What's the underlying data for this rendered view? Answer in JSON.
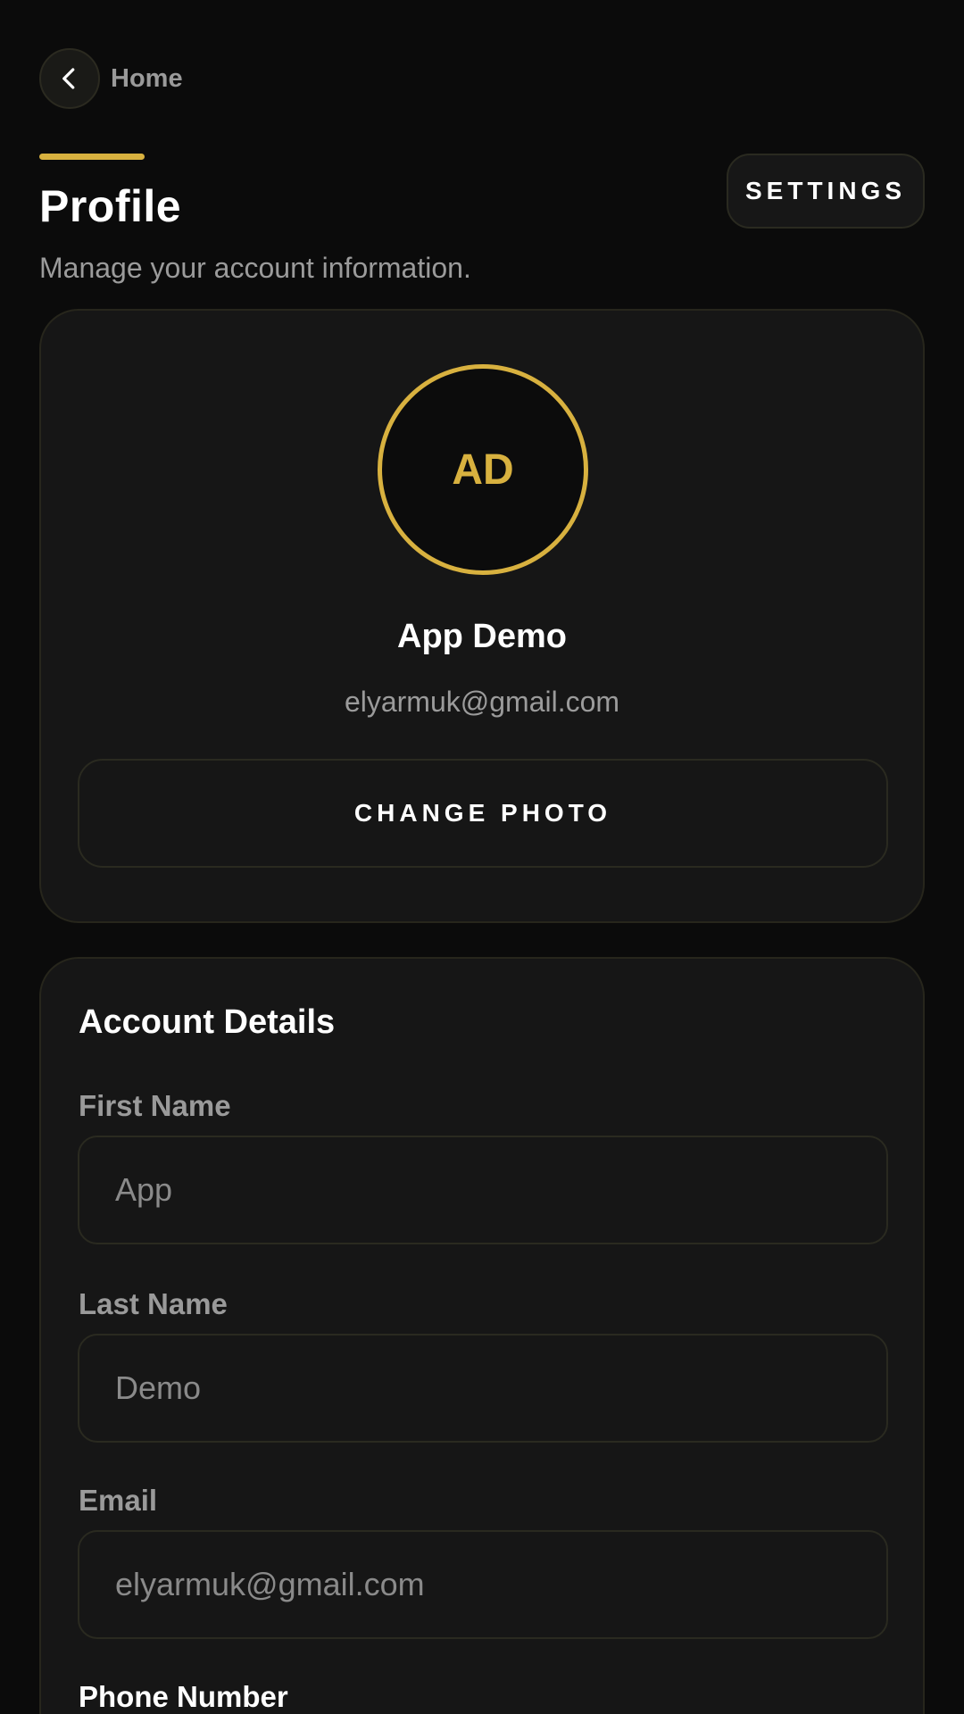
{
  "nav": {
    "back_label": "Home"
  },
  "header": {
    "title": "Profile",
    "subtitle": "Manage your account information.",
    "settings_label": "SETTINGS"
  },
  "profile": {
    "initials": "AD",
    "name": "App Demo",
    "email": "elyarmuk@gmail.com",
    "change_photo_label": "CHANGE PHOTO"
  },
  "account_details": {
    "title": "Account Details",
    "fields": {
      "first_name": {
        "label": "First Name",
        "value": "App"
      },
      "last_name": {
        "label": "Last Name",
        "value": "Demo"
      },
      "email": {
        "label": "Email",
        "value": "elyarmuk@gmail.com"
      },
      "phone": {
        "label": "Phone Number"
      }
    }
  },
  "colors": {
    "accent": "#d8b13f",
    "background": "#0b0b0b",
    "card": "#161616",
    "muted_text": "#9b9b9b"
  },
  "icons": {
    "back": "chevron-left-icon"
  }
}
